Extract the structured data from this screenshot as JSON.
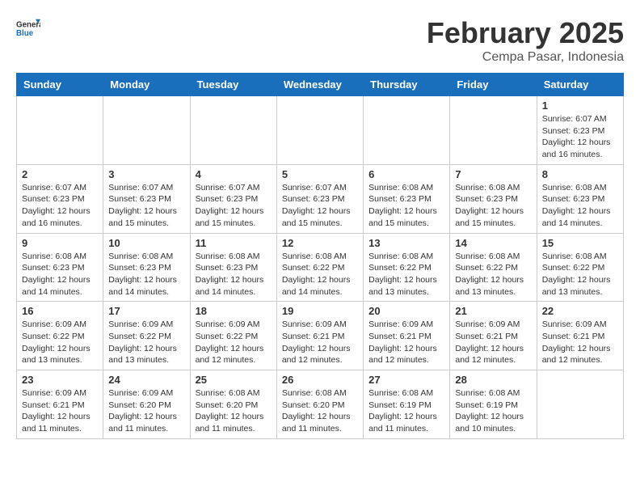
{
  "header": {
    "logo_general": "General",
    "logo_blue": "Blue",
    "month_year": "February 2025",
    "location": "Cempa Pasar, Indonesia"
  },
  "weekdays": [
    "Sunday",
    "Monday",
    "Tuesday",
    "Wednesday",
    "Thursday",
    "Friday",
    "Saturday"
  ],
  "weeks": [
    [
      {
        "day": "",
        "info": ""
      },
      {
        "day": "",
        "info": ""
      },
      {
        "day": "",
        "info": ""
      },
      {
        "day": "",
        "info": ""
      },
      {
        "day": "",
        "info": ""
      },
      {
        "day": "",
        "info": ""
      },
      {
        "day": "1",
        "info": "Sunrise: 6:07 AM\nSunset: 6:23 PM\nDaylight: 12 hours\nand 16 minutes."
      }
    ],
    [
      {
        "day": "2",
        "info": "Sunrise: 6:07 AM\nSunset: 6:23 PM\nDaylight: 12 hours\nand 16 minutes."
      },
      {
        "day": "3",
        "info": "Sunrise: 6:07 AM\nSunset: 6:23 PM\nDaylight: 12 hours\nand 15 minutes."
      },
      {
        "day": "4",
        "info": "Sunrise: 6:07 AM\nSunset: 6:23 PM\nDaylight: 12 hours\nand 15 minutes."
      },
      {
        "day": "5",
        "info": "Sunrise: 6:07 AM\nSunset: 6:23 PM\nDaylight: 12 hours\nand 15 minutes."
      },
      {
        "day": "6",
        "info": "Sunrise: 6:08 AM\nSunset: 6:23 PM\nDaylight: 12 hours\nand 15 minutes."
      },
      {
        "day": "7",
        "info": "Sunrise: 6:08 AM\nSunset: 6:23 PM\nDaylight: 12 hours\nand 15 minutes."
      },
      {
        "day": "8",
        "info": "Sunrise: 6:08 AM\nSunset: 6:23 PM\nDaylight: 12 hours\nand 14 minutes."
      }
    ],
    [
      {
        "day": "9",
        "info": "Sunrise: 6:08 AM\nSunset: 6:23 PM\nDaylight: 12 hours\nand 14 minutes."
      },
      {
        "day": "10",
        "info": "Sunrise: 6:08 AM\nSunset: 6:23 PM\nDaylight: 12 hours\nand 14 minutes."
      },
      {
        "day": "11",
        "info": "Sunrise: 6:08 AM\nSunset: 6:23 PM\nDaylight: 12 hours\nand 14 minutes."
      },
      {
        "day": "12",
        "info": "Sunrise: 6:08 AM\nSunset: 6:22 PM\nDaylight: 12 hours\nand 14 minutes."
      },
      {
        "day": "13",
        "info": "Sunrise: 6:08 AM\nSunset: 6:22 PM\nDaylight: 12 hours\nand 13 minutes."
      },
      {
        "day": "14",
        "info": "Sunrise: 6:08 AM\nSunset: 6:22 PM\nDaylight: 12 hours\nand 13 minutes."
      },
      {
        "day": "15",
        "info": "Sunrise: 6:08 AM\nSunset: 6:22 PM\nDaylight: 12 hours\nand 13 minutes."
      }
    ],
    [
      {
        "day": "16",
        "info": "Sunrise: 6:09 AM\nSunset: 6:22 PM\nDaylight: 12 hours\nand 13 minutes."
      },
      {
        "day": "17",
        "info": "Sunrise: 6:09 AM\nSunset: 6:22 PM\nDaylight: 12 hours\nand 13 minutes."
      },
      {
        "day": "18",
        "info": "Sunrise: 6:09 AM\nSunset: 6:22 PM\nDaylight: 12 hours\nand 12 minutes."
      },
      {
        "day": "19",
        "info": "Sunrise: 6:09 AM\nSunset: 6:21 PM\nDaylight: 12 hours\nand 12 minutes."
      },
      {
        "day": "20",
        "info": "Sunrise: 6:09 AM\nSunset: 6:21 PM\nDaylight: 12 hours\nand 12 minutes."
      },
      {
        "day": "21",
        "info": "Sunrise: 6:09 AM\nSunset: 6:21 PM\nDaylight: 12 hours\nand 12 minutes."
      },
      {
        "day": "22",
        "info": "Sunrise: 6:09 AM\nSunset: 6:21 PM\nDaylight: 12 hours\nand 12 minutes."
      }
    ],
    [
      {
        "day": "23",
        "info": "Sunrise: 6:09 AM\nSunset: 6:21 PM\nDaylight: 12 hours\nand 11 minutes."
      },
      {
        "day": "24",
        "info": "Sunrise: 6:09 AM\nSunset: 6:20 PM\nDaylight: 12 hours\nand 11 minutes."
      },
      {
        "day": "25",
        "info": "Sunrise: 6:08 AM\nSunset: 6:20 PM\nDaylight: 12 hours\nand 11 minutes."
      },
      {
        "day": "26",
        "info": "Sunrise: 6:08 AM\nSunset: 6:20 PM\nDaylight: 12 hours\nand 11 minutes."
      },
      {
        "day": "27",
        "info": "Sunrise: 6:08 AM\nSunset: 6:19 PM\nDaylight: 12 hours\nand 11 minutes."
      },
      {
        "day": "28",
        "info": "Sunrise: 6:08 AM\nSunset: 6:19 PM\nDaylight: 12 hours\nand 10 minutes."
      },
      {
        "day": "",
        "info": ""
      }
    ]
  ]
}
